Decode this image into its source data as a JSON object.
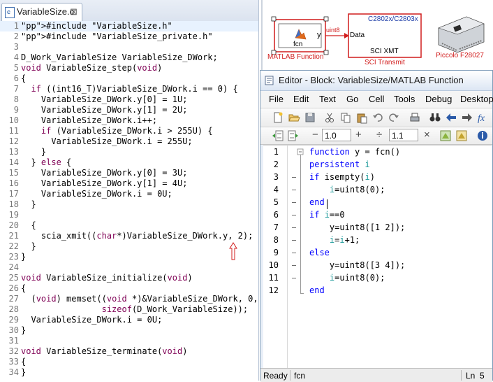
{
  "c_editor": {
    "tab_label": "VariableSize.c",
    "tab_close": "⊠",
    "file_badge": "c",
    "lines": [
      {
        "n": "1",
        "code": "#include \"VariableSize.h\""
      },
      {
        "n": "2",
        "code": "#include \"VariableSize_private.h\""
      },
      {
        "n": "3",
        "code": ""
      },
      {
        "n": "4",
        "code": "D_Work_VariableSize VariableSize_DWork;"
      },
      {
        "n": "5",
        "code": "void VariableSize_step(void)"
      },
      {
        "n": "6",
        "code": "{"
      },
      {
        "n": "7",
        "code": "  if ((int16_T)VariableSize_DWork.i == 0) {"
      },
      {
        "n": "8",
        "code": "    VariableSize_DWork.y[0] = 1U;"
      },
      {
        "n": "9",
        "code": "    VariableSize_DWork.y[1] = 2U;"
      },
      {
        "n": "10",
        "code": "    VariableSize_DWork.i++;"
      },
      {
        "n": "11",
        "code": "    if (VariableSize_DWork.i > 255U) {"
      },
      {
        "n": "12",
        "code": "      VariableSize_DWork.i = 255U;"
      },
      {
        "n": "13",
        "code": "    }"
      },
      {
        "n": "14",
        "code": "  } else {"
      },
      {
        "n": "15",
        "code": "    VariableSize_DWork.y[0] = 3U;"
      },
      {
        "n": "16",
        "code": "    VariableSize_DWork.y[1] = 4U;"
      },
      {
        "n": "17",
        "code": "    VariableSize_DWork.i = 0U;"
      },
      {
        "n": "18",
        "code": "  }"
      },
      {
        "n": "19",
        "code": ""
      },
      {
        "n": "20",
        "code": "  {"
      },
      {
        "n": "21",
        "code": "    scia_xmit((char*)VariableSize_DWork.y, 2);"
      },
      {
        "n": "22",
        "code": "  }"
      },
      {
        "n": "23",
        "code": "}"
      },
      {
        "n": "24",
        "code": ""
      },
      {
        "n": "25",
        "code": "void VariableSize_initialize(void)"
      },
      {
        "n": "26",
        "code": "{"
      },
      {
        "n": "27",
        "code": "  (void) memset((void *)&VariableSize_DWork, 0,"
      },
      {
        "n": "28",
        "code": "                sizeof(D_Work_VariableSize));"
      },
      {
        "n": "29",
        "code": "  VariableSize_DWork.i = 0U;"
      },
      {
        "n": "30",
        "code": "}"
      },
      {
        "n": "31",
        "code": ""
      },
      {
        "n": "32",
        "code": "void VariableSize_terminate(void)"
      },
      {
        "n": "33",
        "code": "{"
      },
      {
        "n": "34",
        "code": "}"
      }
    ]
  },
  "simulink": {
    "fcn_block_label": "fcn",
    "fcn_port_label": "y",
    "fcn_caption": "MATLAB Function",
    "signal_label": "uint8",
    "sci_header": "C2802x/C2803x",
    "sci_port_label": "Data",
    "sci_block_label": "SCI XMT",
    "sci_caption": "SCI Transmit",
    "board_caption": "Piccolo F28027",
    "accent_red": "#d11d1d",
    "caption_blue": "#1f3ea8"
  },
  "matlab_editor": {
    "title": "Editor - Block: VariableSize/MATLAB Function",
    "menus": [
      "File",
      "Edit",
      "Text",
      "Go",
      "Cell",
      "Tools",
      "Debug",
      "Desktop"
    ],
    "cell_minus": "−",
    "cell_value_1": "1.0",
    "cell_plus": "+",
    "cell_divide": "÷",
    "cell_value_2": "1.1",
    "cell_times": "×",
    "lines": [
      {
        "n": "1",
        "dash": false,
        "code": "function y = fcn()"
      },
      {
        "n": "2",
        "dash": false,
        "code": "persistent i"
      },
      {
        "n": "3",
        "dash": true,
        "code": "if isempty(i)"
      },
      {
        "n": "4",
        "dash": true,
        "code": "    i=uint8(0);"
      },
      {
        "n": "5",
        "dash": true,
        "code": "end"
      },
      {
        "n": "6",
        "dash": true,
        "code": "if i==0"
      },
      {
        "n": "7",
        "dash": true,
        "code": "    y=uint8([1 2]);"
      },
      {
        "n": "8",
        "dash": true,
        "code": "    i=i+1;"
      },
      {
        "n": "9",
        "dash": true,
        "code": "else"
      },
      {
        "n": "10",
        "dash": true,
        "code": "    y=uint8([3 4]);"
      },
      {
        "n": "11",
        "dash": true,
        "code": "    i=uint8(0);"
      },
      {
        "n": "12",
        "dash": false,
        "code": "end"
      }
    ],
    "status_ready": "Ready",
    "status_function": "fcn",
    "status_line_label": "Ln",
    "status_line_value": "5"
  }
}
